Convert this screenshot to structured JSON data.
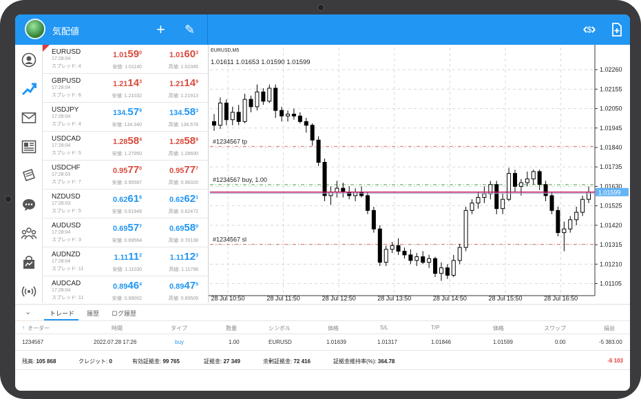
{
  "header": {
    "title": "気配値",
    "add_icon": "+",
    "edit_icon": "✎"
  },
  "nav_icons": [
    "account-icon",
    "trade-icon",
    "mail-icon",
    "news-icon",
    "journal-icon",
    "chat-icon",
    "community-icon",
    "market-icon",
    "signal-icon"
  ],
  "quotes": [
    {
      "symbol": "EURUSD",
      "time": "17:28:04",
      "spread": "スプレッド: 4",
      "bid_pre": "1.01",
      "bid_big": "59",
      "bid_sup": "0",
      "ask_pre": "1.01",
      "ask_big": "60",
      "ask_sup": "3",
      "low": "安値: 1.01140",
      "high": "高値: 1.02345",
      "color": "red"
    },
    {
      "symbol": "GBPUSD",
      "time": "17:28:04",
      "spread": "スプレッド: 6",
      "bid_pre": "1.21",
      "bid_big": "14",
      "bid_sup": "3",
      "ask_pre": "1.21",
      "ask_big": "14",
      "ask_sup": "9",
      "low": "安値: 1.21032",
      "high": "高値: 1.21913",
      "color": "red"
    },
    {
      "symbol": "USDJPY",
      "time": "17:28:04",
      "spread": "スプレッド: 4",
      "bid_pre": "134.",
      "bid_big": "57",
      "bid_sup": "9",
      "ask_pre": "134.",
      "ask_big": "58",
      "ask_sup": "3",
      "low": "安値: 134.340",
      "high": "高値: 136.578",
      "color": "blue"
    },
    {
      "symbol": "USDCAD",
      "time": "17:28:04",
      "spread": "スプレッド: 5",
      "bid_pre": "1.28",
      "bid_big": "58",
      "bid_sup": "4",
      "ask_pre": "1.28",
      "ask_big": "58",
      "ask_sup": "9",
      "low": "安値: 1.27950",
      "high": "高値: 1.28600",
      "color": "red"
    },
    {
      "symbol": "USDCHF",
      "time": "17:28:03",
      "spread": "スプレッド: 7",
      "bid_pre": "0.95",
      "bid_big": "77",
      "bid_sup": "0",
      "ask_pre": "0.95",
      "ask_big": "77",
      "ask_sup": "7",
      "low": "安値: 0.95587",
      "high": "高値: 0.96320",
      "color": "red"
    },
    {
      "symbol": "NZDUSD",
      "time": "17:28:03",
      "spread": "スプレッド: 5",
      "bid_pre": "0.62",
      "bid_big": "61",
      "bid_sup": "6",
      "ask_pre": "0.62",
      "ask_big": "62",
      "ask_sup": "1",
      "low": "安値: 0.61949",
      "high": "高値: 0.62472",
      "color": "blue"
    },
    {
      "symbol": "AUDUSD",
      "time": "17:28:04",
      "spread": "スプレッド: 3",
      "bid_pre": "0.69",
      "bid_big": "57",
      "bid_sup": "7",
      "ask_pre": "0.69",
      "ask_big": "58",
      "ask_sup": "0",
      "low": "安値: 0.69564",
      "high": "高値: 0.70138",
      "color": "blue"
    },
    {
      "symbol": "AUDNZD",
      "time": "17:28:04",
      "spread": "スプレッド: 11",
      "bid_pre": "1.11",
      "bid_big": "11",
      "bid_sup": "2",
      "ask_pre": "1.11",
      "ask_big": "12",
      "ask_sup": "3",
      "low": "安値: 1.11030",
      "high": "高値: 1.11796",
      "color": "blue"
    },
    {
      "symbol": "AUDCAD",
      "time": "17:28:04",
      "spread": "スプレッド: 11",
      "bid_pre": "0.89",
      "bid_big": "46",
      "bid_sup": "4",
      "ask_pre": "0.89",
      "ask_big": "47",
      "ask_sup": "5",
      "low": "安値: 0.89002",
      "high": "高値: 0.89509",
      "color": "blue"
    }
  ],
  "chart_data": {
    "type": "candlestick",
    "symbol_label": "EURUSD,M5",
    "ohlc_label": "1.01611 1.01653 1.01590 1.01599",
    "ylim": [
      1.0104,
      1.0232
    ],
    "yticks": [
      "1.02260",
      "1.02155",
      "1.02050",
      "1.01945",
      "1.01840",
      "1.01735",
      "1.01630",
      "1.01525",
      "1.01420",
      "1.01315",
      "1.01210",
      "1.01105"
    ],
    "ytick_values": [
      1.0226,
      1.02155,
      1.0205,
      1.01945,
      1.0184,
      1.01735,
      1.0163,
      1.01525,
      1.0142,
      1.01315,
      1.0121,
      1.01105
    ],
    "xticks": [
      "28 Jul 10:50",
      "28 Jul 11:50",
      "28 Jul 12:50",
      "28 Jul 13:50",
      "28 Jul 14:50",
      "28 Jul 15:50",
      "28 Jul 16:50"
    ],
    "current_price": "1.01599",
    "current_value": 1.01599,
    "levels": [
      {
        "label": "#1234567   tp",
        "value": 1.01846,
        "color": "#e57373"
      },
      {
        "label": "#1234567   buy, 1.00",
        "value": 1.01639,
        "color": "#43a047"
      },
      {
        "label": "#1234567   sl",
        "value": 1.01317,
        "color": "#e57373"
      }
    ],
    "candles": [
      [
        1.0198,
        1.0202,
        1.0193,
        1.0196
      ],
      [
        1.0196,
        1.0211,
        1.0194,
        1.0208
      ],
      [
        1.0208,
        1.021,
        1.0196,
        1.0199
      ],
      [
        1.0199,
        1.0206,
        1.0196,
        1.0203
      ],
      [
        1.0203,
        1.0207,
        1.0196,
        1.0198
      ],
      [
        1.0198,
        1.0213,
        1.0197,
        1.021
      ],
      [
        1.021,
        1.0212,
        1.0203,
        1.0206
      ],
      [
        1.0206,
        1.0218,
        1.0204,
        1.0214
      ],
      [
        1.0214,
        1.0216,
        1.0207,
        1.0209
      ],
      [
        1.0209,
        1.0218,
        1.0208,
        1.0216
      ],
      [
        1.0216,
        1.0218,
        1.02,
        1.0204
      ],
      [
        1.0204,
        1.0206,
        1.0198,
        1.0201
      ],
      [
        1.0201,
        1.0204,
        1.0198,
        1.0202
      ],
      [
        1.0202,
        1.0205,
        1.0199,
        1.0201
      ],
      [
        1.0201,
        1.0203,
        1.0197,
        1.0198
      ],
      [
        1.0198,
        1.02,
        1.0192,
        1.0196
      ],
      [
        1.0196,
        1.0197,
        1.0185,
        1.0188
      ],
      [
        1.0188,
        1.019,
        1.0174,
        1.0176
      ],
      [
        1.0176,
        1.0178,
        1.0155,
        1.0158
      ],
      [
        1.0158,
        1.0163,
        1.0153,
        1.016
      ],
      [
        1.016,
        1.0166,
        1.0157,
        1.0162
      ],
      [
        1.0162,
        1.0165,
        1.0157,
        1.016
      ],
      [
        1.016,
        1.0163,
        1.0156,
        1.0158
      ],
      [
        1.0158,
        1.0162,
        1.0155,
        1.016
      ],
      [
        1.016,
        1.0163,
        1.0157,
        1.0158
      ],
      [
        1.0158,
        1.016,
        1.0148,
        1.015
      ],
      [
        1.015,
        1.0152,
        1.0138,
        1.014
      ],
      [
        1.014,
        1.0142,
        1.012,
        1.0122
      ],
      [
        1.0122,
        1.0131,
        1.012,
        1.0129
      ],
      [
        1.0129,
        1.0133,
        1.0127,
        1.0131
      ],
      [
        1.0131,
        1.0135,
        1.0126,
        1.0128
      ],
      [
        1.0128,
        1.013,
        1.0124,
        1.0126
      ],
      [
        1.0126,
        1.0129,
        1.0121,
        1.0123
      ],
      [
        1.0123,
        1.0127,
        1.012,
        1.0125
      ],
      [
        1.0125,
        1.0128,
        1.0121,
        1.0122
      ],
      [
        1.0122,
        1.0126,
        1.0119,
        1.0124
      ],
      [
        1.0124,
        1.0125,
        1.0114,
        1.0116
      ],
      [
        1.0116,
        1.0122,
        1.0112,
        1.0119
      ],
      [
        1.0119,
        1.0121,
        1.0113,
        1.0115
      ],
      [
        1.0115,
        1.0126,
        1.0114,
        1.0123
      ],
      [
        1.0123,
        1.0132,
        1.0121,
        1.013
      ],
      [
        1.013,
        1.0152,
        1.0128,
        1.015
      ],
      [
        1.015,
        1.0156,
        1.0148,
        1.0154
      ],
      [
        1.0154,
        1.016,
        1.0151,
        1.0157
      ],
      [
        1.0157,
        1.0163,
        1.0154,
        1.0159
      ],
      [
        1.0159,
        1.0166,
        1.0156,
        1.0164
      ],
      [
        1.0164,
        1.0166,
        1.0148,
        1.0151
      ],
      [
        1.0151,
        1.0159,
        1.0148,
        1.0156
      ],
      [
        1.0156,
        1.0173,
        1.0155,
        1.017
      ],
      [
        1.017,
        1.0172,
        1.016,
        1.0163
      ],
      [
        1.0163,
        1.0167,
        1.0158,
        1.0165
      ],
      [
        1.0165,
        1.0171,
        1.0163,
        1.0167
      ],
      [
        1.0167,
        1.0172,
        1.0164,
        1.0171
      ],
      [
        1.0171,
        1.0172,
        1.0161,
        1.0164
      ],
      [
        1.0164,
        1.0166,
        1.0155,
        1.0158
      ],
      [
        1.0158,
        1.016,
        1.0148,
        1.015
      ],
      [
        1.015,
        1.0152,
        1.0136,
        1.0138
      ],
      [
        1.0138,
        1.0144,
        1.0128,
        1.014
      ],
      [
        1.014,
        1.0147,
        1.0138,
        1.0145
      ],
      [
        1.0145,
        1.0152,
        1.0142,
        1.0149
      ],
      [
        1.0149,
        1.0158,
        1.0147,
        1.0156
      ],
      [
        1.0156,
        1.0163,
        1.0154,
        1.016
      ]
    ]
  },
  "tabs": [
    "トレード",
    "履歴",
    "ログ履歴"
  ],
  "table": {
    "headers": [
      "オーダー",
      "時間",
      "タイプ",
      "数量",
      "シンボル",
      "価格",
      "S/L",
      "T/P",
      "価格",
      "スワップ",
      "損益"
    ],
    "row": [
      "1234567",
      "2022.07.28 17:26",
      "buy",
      "1.00",
      "EURUSD",
      "1.01639",
      "1.01317",
      "1.01846",
      "1.01599",
      "0.00",
      "-5 383.00"
    ]
  },
  "summary": {
    "balance_label": "残高:",
    "balance": "105 868",
    "credit_label": "クレジット:",
    "credit": "0",
    "equity_label": "有効証拠金:",
    "equity": "99 765",
    "margin_label": "証拠金:",
    "margin": "27 349",
    "free_label": "余剰証拠金:",
    "free": "72 416",
    "level_label": "証拠金維持率(%):",
    "level": "364.78",
    "profit": "-6 103"
  }
}
